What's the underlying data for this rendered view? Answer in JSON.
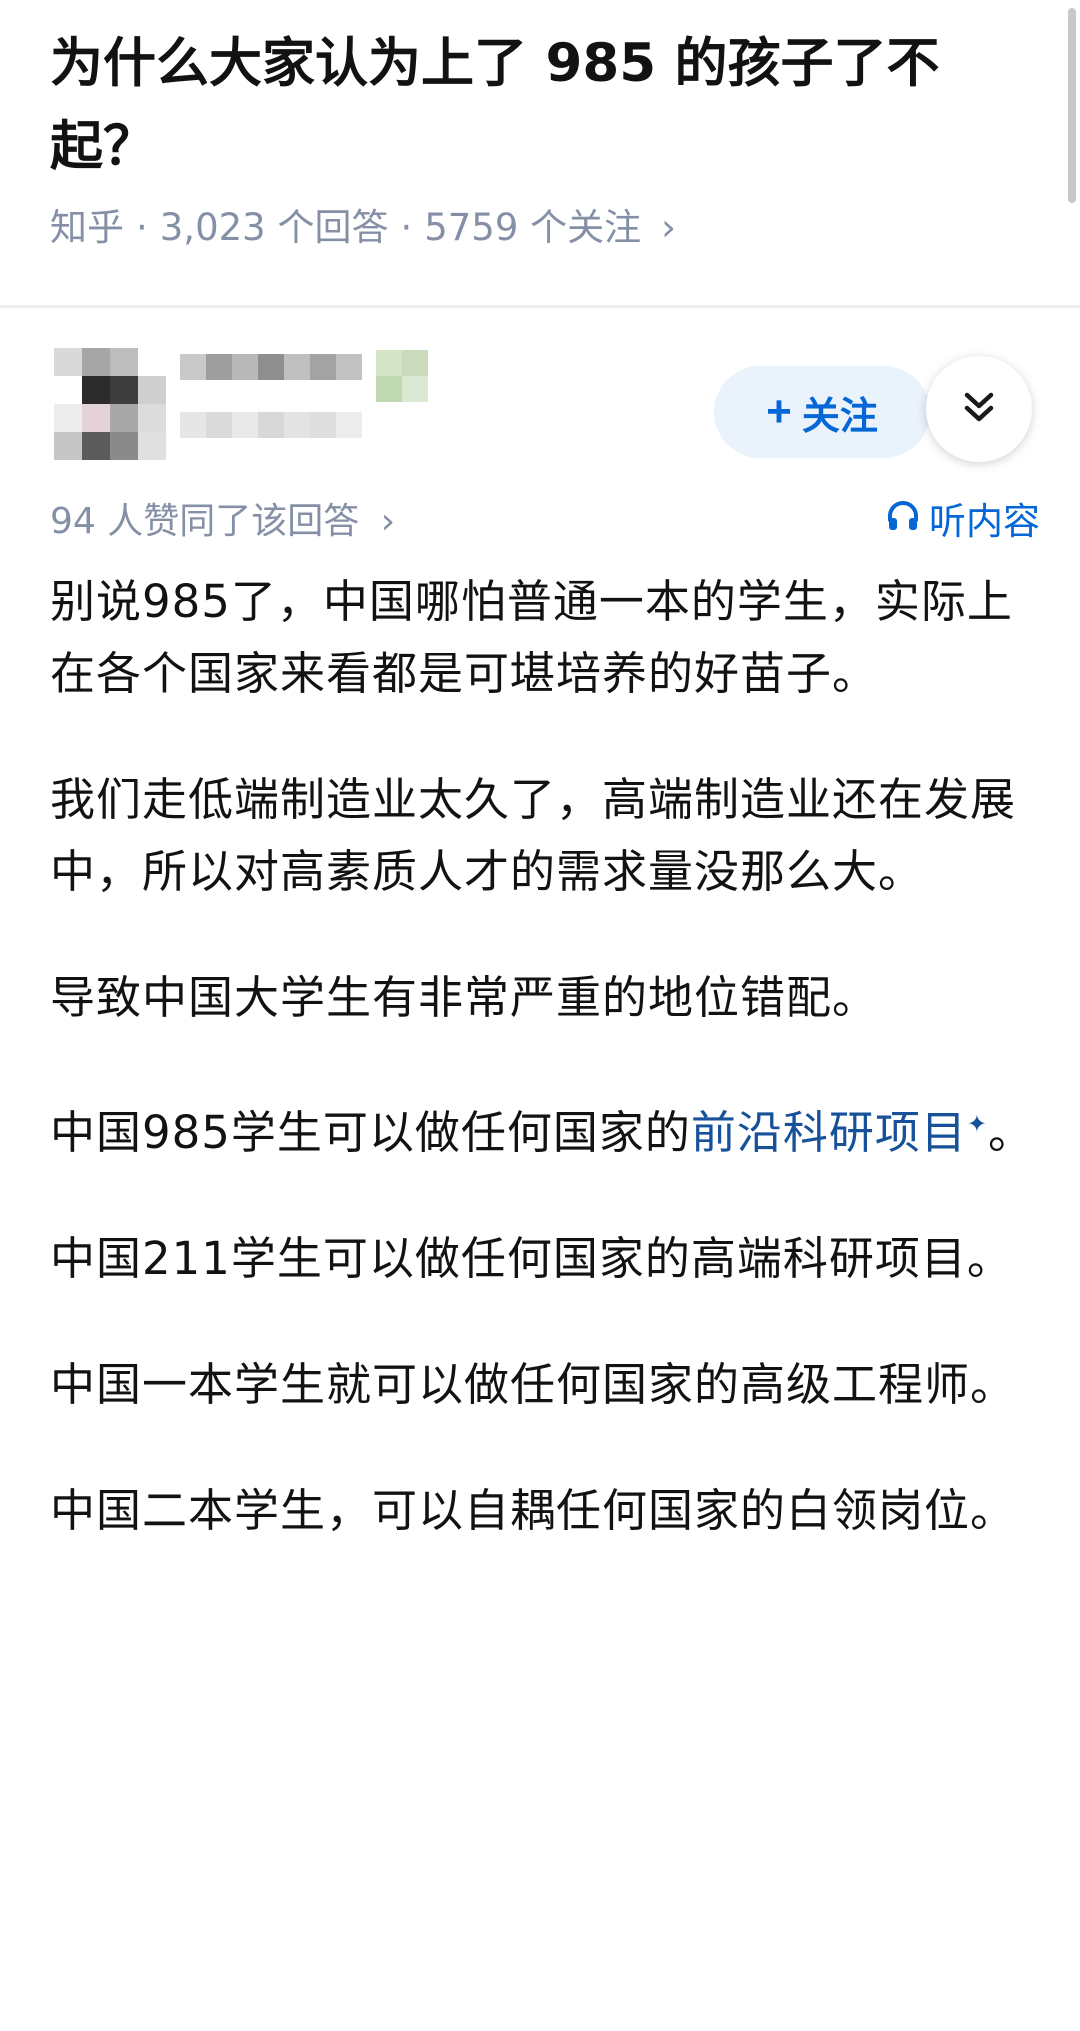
{
  "question": {
    "title": "为什么大家认为上了 985 的孩子了不起？",
    "source": "知乎",
    "answers_count": "3,023 个回答",
    "followers_count": "5759 个关注",
    "separator": "·",
    "chevron": "›"
  },
  "author": {
    "follow_label": "关注",
    "follow_icon": "plus-icon",
    "expand_icon": "double-chevron-down-icon"
  },
  "vote": {
    "text": "94 人赞同了该回答",
    "chevron": "›",
    "listen_label": "听内容",
    "listen_icon": "headphones-icon"
  },
  "answer": {
    "p1": "别说985了，中国哪怕普通一本的学生，实际上在各个国家来看都是可堪培养的好苗子。",
    "p2": "我们走低端制造业太久了，高端制造业还在发展中，所以对高素质人才的需求量没那么大。",
    "p3": "导致中国大学生有非常严重的地位错配。",
    "p4_prefix": "中国985学生可以做任何国家的",
    "p4_link": "前沿科研项目",
    "p4_link_mark": "✦",
    "p4_suffix": "。",
    "p5": "中国211学生可以做任何国家的高端科研项目。",
    "p6": "中国一本学生就可以做任何国家的高级工程师。",
    "p7": "中国二本学生，可以自耦任何国家的白领岗位。"
  },
  "colors": {
    "accent": "#0566d6",
    "link": "#175199",
    "meta": "#8590a6",
    "follow_bg": "#eaf2fc"
  }
}
